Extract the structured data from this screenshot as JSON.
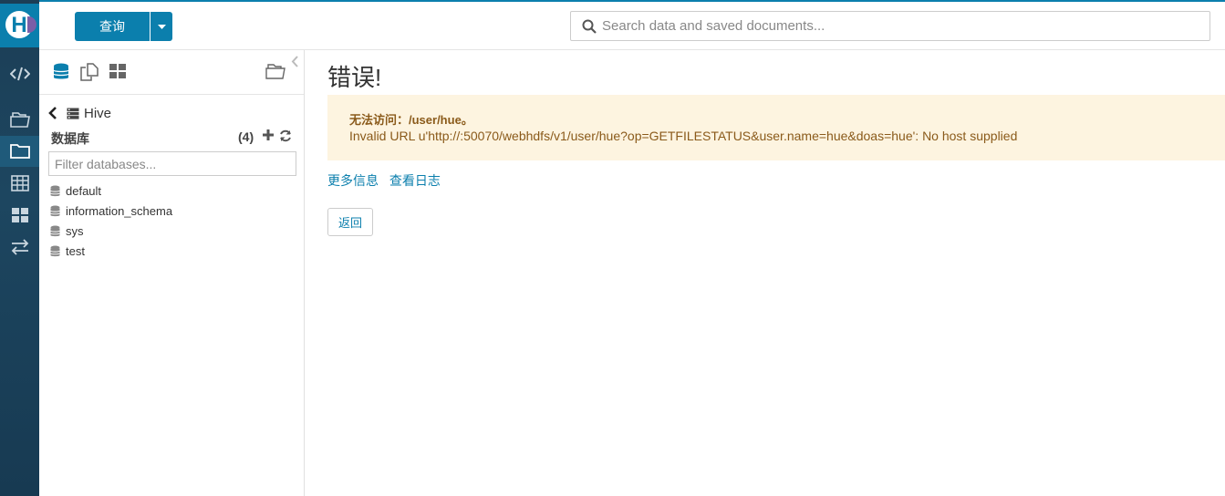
{
  "header": {
    "query_button": "查询",
    "search_placeholder": "Search data and saved documents..."
  },
  "rail": {
    "items": [
      "editor-icon",
      "documents-icon",
      "files-icon",
      "tables-icon",
      "dashboard-icon",
      "jobs-icon"
    ],
    "active": "files-icon"
  },
  "panel": {
    "breadcrumb": "Hive",
    "section_title": "数据库",
    "count": "(4)",
    "filter_placeholder": "Filter databases...",
    "databases": [
      "default",
      "information_schema",
      "sys",
      "test"
    ]
  },
  "main": {
    "title": "错误!",
    "alert_line1": "无法访问：/user/hue。",
    "alert_line2": "Invalid URL u'http://:50070/webhdfs/v1/user/hue?op=GETFILESTATUS&user.name=hue&doas=hue': No host supplied",
    "link_more": "更多信息",
    "link_logs": "查看日志",
    "back_button": "返回"
  },
  "colors": {
    "accent": "#0b7fad",
    "rail_bg": "#1d4660",
    "alert_bg": "#fdf4e0",
    "alert_text": "#8a5a1a"
  }
}
